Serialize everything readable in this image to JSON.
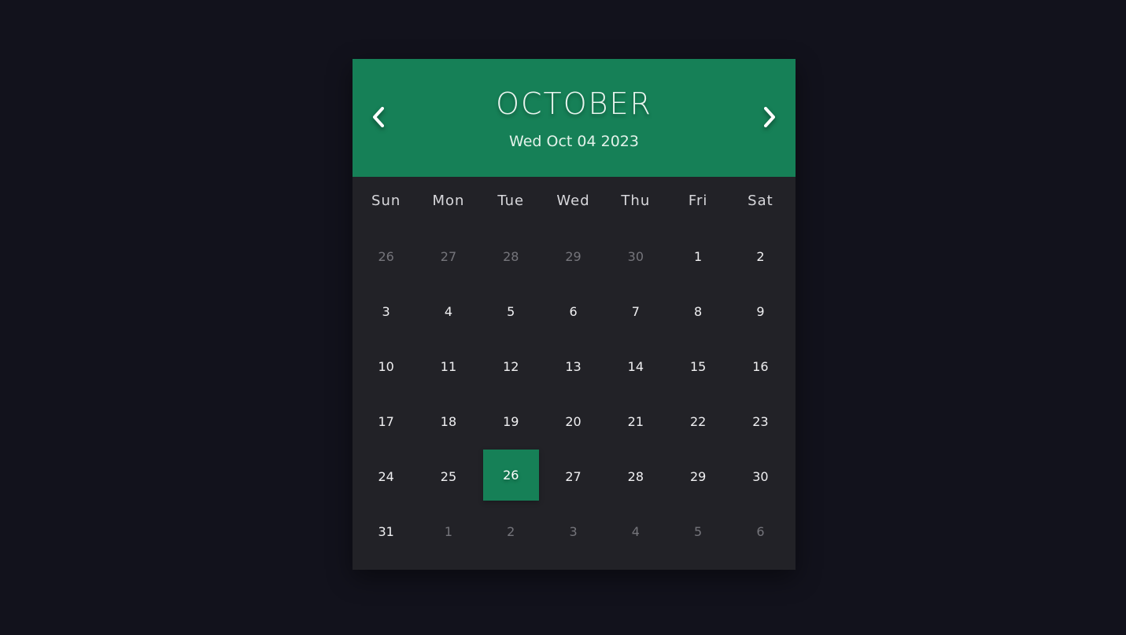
{
  "colors": {
    "background": "#12121c",
    "panel": "#222227",
    "accent": "#168057"
  },
  "header": {
    "month": "OCTOBER",
    "selected_date": "Wed Oct 04 2023",
    "prev_icon": "chevron-left-icon",
    "next_icon": "chevron-right-icon"
  },
  "weekdays": [
    "Sun",
    "Mon",
    "Tue",
    "Wed",
    "Thu",
    "Fri",
    "Sat"
  ],
  "days": [
    {
      "label": "26",
      "muted": true
    },
    {
      "label": "27",
      "muted": true
    },
    {
      "label": "28",
      "muted": true
    },
    {
      "label": "29",
      "muted": true
    },
    {
      "label": "30",
      "muted": true
    },
    {
      "label": "1"
    },
    {
      "label": "2"
    },
    {
      "label": "3"
    },
    {
      "label": "4"
    },
    {
      "label": "5"
    },
    {
      "label": "6"
    },
    {
      "label": "7"
    },
    {
      "label": "8"
    },
    {
      "label": "9"
    },
    {
      "label": "10"
    },
    {
      "label": "11"
    },
    {
      "label": "12"
    },
    {
      "label": "13"
    },
    {
      "label": "14"
    },
    {
      "label": "15"
    },
    {
      "label": "16"
    },
    {
      "label": "17"
    },
    {
      "label": "18"
    },
    {
      "label": "19"
    },
    {
      "label": "20"
    },
    {
      "label": "21"
    },
    {
      "label": "22"
    },
    {
      "label": "23"
    },
    {
      "label": "24"
    },
    {
      "label": "25"
    },
    {
      "label": "26",
      "highlighted": true
    },
    {
      "label": "27"
    },
    {
      "label": "28"
    },
    {
      "label": "29"
    },
    {
      "label": "30"
    },
    {
      "label": "31"
    },
    {
      "label": "1",
      "muted": true
    },
    {
      "label": "2",
      "muted": true
    },
    {
      "label": "3",
      "muted": true
    },
    {
      "label": "4",
      "muted": true
    },
    {
      "label": "5",
      "muted": true
    },
    {
      "label": "6",
      "muted": true
    }
  ]
}
